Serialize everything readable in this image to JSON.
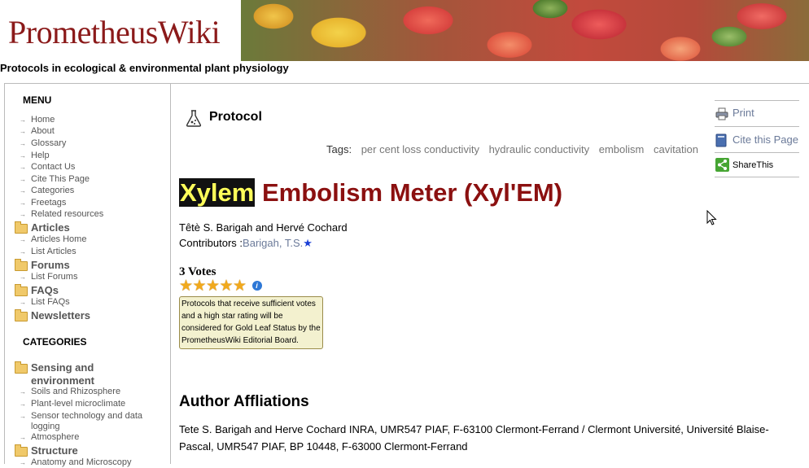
{
  "site": {
    "logo_text": "PrometheusWiki",
    "tagline": "Protocols in ecological & environmental plant physiology"
  },
  "sidebar": {
    "menu_heading": "MENU",
    "menu_items": [
      "Home",
      "About",
      "Glossary",
      "Help",
      "Contact Us",
      "Cite This Page",
      "Categories",
      "Freetags",
      "Related resources"
    ],
    "articles": {
      "label": "Articles",
      "items": [
        "Articles Home",
        "List Articles"
      ]
    },
    "forums": {
      "label": "Forums",
      "items": [
        "List Forums"
      ]
    },
    "faqs": {
      "label": "FAQs",
      "items": [
        "List FAQs"
      ]
    },
    "newsletters": {
      "label": "Newsletters"
    },
    "categories_heading": "CATEGORIES",
    "sensing": {
      "label": "Sensing and environment",
      "items": [
        "Soils and Rhizosphere",
        "Plant-level microclimate",
        "Sensor technology and data logging",
        "Atmosphere"
      ]
    },
    "structure": {
      "label": "Structure",
      "items": [
        "Anatomy and Microscopy"
      ]
    }
  },
  "main": {
    "section_label": "Protocol",
    "tags_label": "Tags:",
    "tags": [
      "per cent loss conductivity",
      "hydraulic conductivity",
      "embolism",
      "cavitation"
    ],
    "title_highlight": "Xylem",
    "title_rest": " Embolism Meter (Xyl'EM)",
    "authors": "Têtè S. Barigah and Hervé Cochard",
    "contributors_label": "Contributors :",
    "contributor": "Barigah, T.S.",
    "votes": "3 Votes",
    "rating_stars": 5,
    "vote_note": "Protocols that receive sufficient votes and a high star rating will be considered for Gold Leaf Status by the PrometheusWiki Editorial Board.",
    "affiliations_heading": "Author Affliations",
    "affiliations_text": "Tete S. Barigah and Herve Cochard INRA, UMR547 PIAF, F-63100 Clermont-Ferrand / Clermont Université, Université Blaise-Pascal, UMR547 PIAF, BP 10448, F-63000 Clermont-Ferrand"
  },
  "tools": {
    "print": "Print",
    "cite": "Cite this Page",
    "share": "ShareThis"
  },
  "colors": {
    "title": "#8b1010",
    "highlight_bg": "#111111",
    "highlight_fg": "#ffff5a",
    "link": "#6b7a99",
    "note_bg": "#f3f1cf"
  }
}
